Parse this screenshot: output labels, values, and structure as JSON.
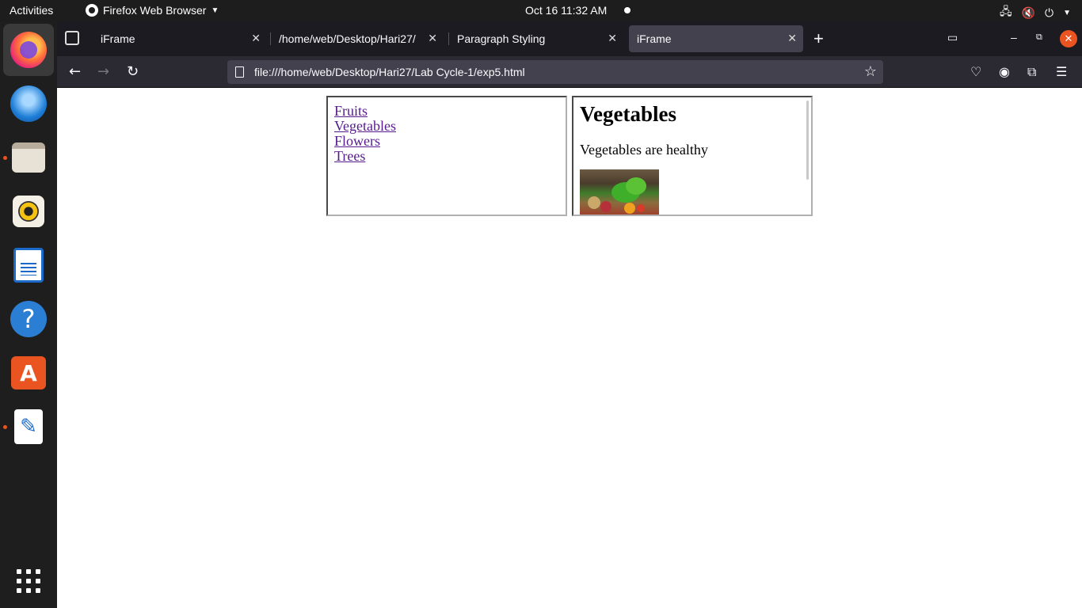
{
  "topbar": {
    "activities": "Activities",
    "app_name": "Firefox Web Browser",
    "clock": "Oct 16  11:32 AM"
  },
  "dock": {
    "items": [
      "firefox",
      "thunderbird",
      "files",
      "rhythmbox",
      "libreoffice-writer",
      "help",
      "app-center",
      "text-editor",
      "show-apps"
    ]
  },
  "browser": {
    "tabs": [
      {
        "title": "iFrame",
        "active": false
      },
      {
        "title": "/home/web/Desktop/Hari27/",
        "active": false
      },
      {
        "title": "Paragraph Styling",
        "active": false
      },
      {
        "title": "iFrame",
        "active": true
      }
    ],
    "url": "file:///home/web/Desktop/Hari27/Lab Cycle-1/exp5.html"
  },
  "page": {
    "links": [
      "Fruits",
      "Vegetables",
      "Flowers",
      "Trees"
    ],
    "heading": "Vegetables",
    "paragraph": "Vegetables are healthy"
  },
  "colors": {
    "accent": "#e95420",
    "visited_link": "#551a8b",
    "tabbar_bg": "#1c1b22",
    "navbar_bg": "#2b2a33"
  }
}
